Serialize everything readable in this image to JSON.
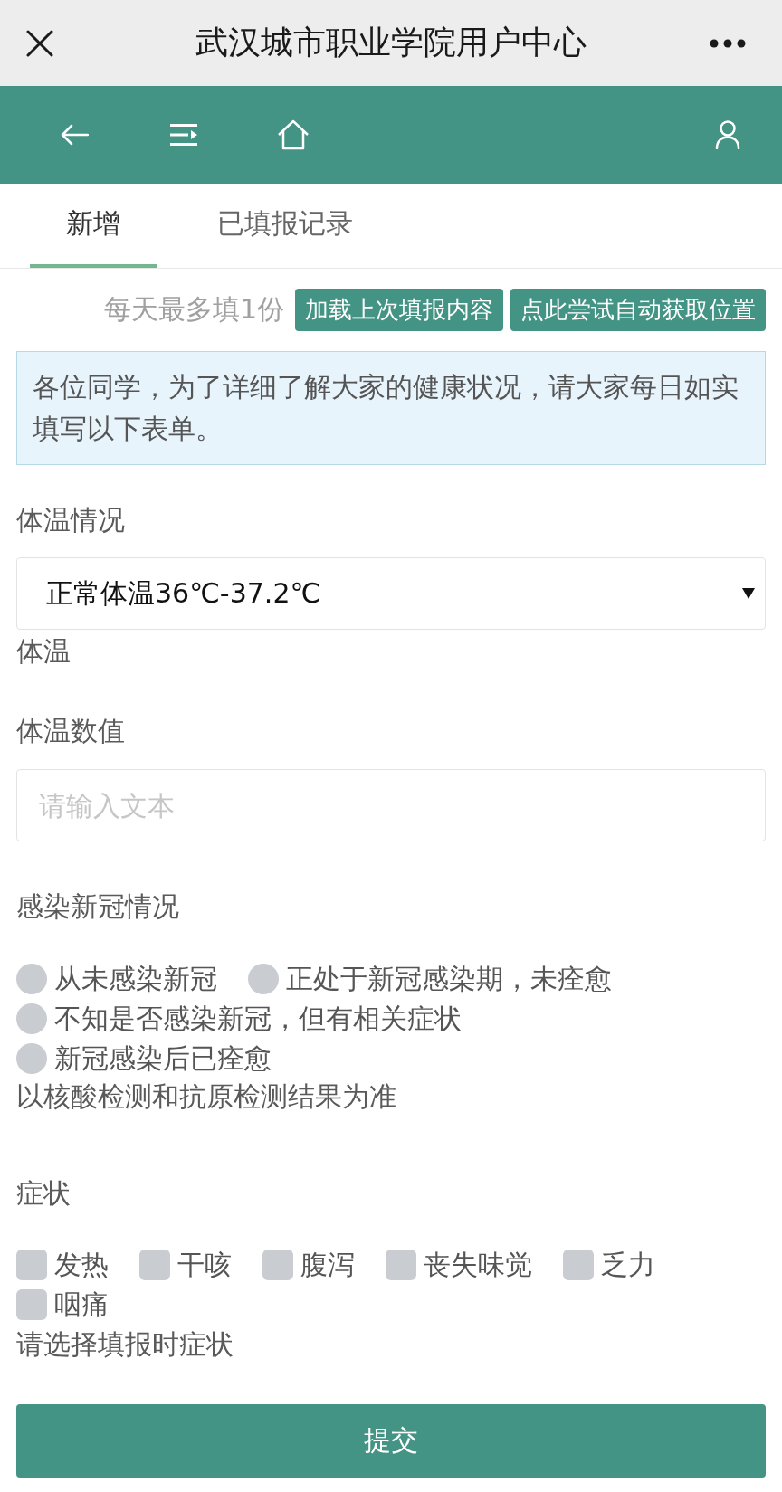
{
  "title_bar": {
    "title": "武汉城市职业学院用户中心"
  },
  "tabs": [
    {
      "label": "新增",
      "selected": true
    },
    {
      "label": "已填报记录",
      "selected": false
    }
  ],
  "toolbar": {
    "limit_note": "每天最多填1份",
    "buttons": [
      "加载上次填报内容",
      "点此尝试自动获取位置"
    ]
  },
  "notice": "各位同学，为了详细了解大家的健康状况，请大家每日如实填写以下表单。",
  "form": {
    "fields": [
      {
        "kind": "select",
        "label": "体温情况",
        "value": "正常体温36℃-37.2℃",
        "help": "体温"
      },
      {
        "kind": "text",
        "label": "体温数值",
        "placeholder": "请输入文本"
      },
      {
        "kind": "radio",
        "label": "感染新冠情况",
        "options": [
          {
            "label": "从未感染新冠",
            "selected": false
          },
          {
            "label": "正处于新冠感染期，未痊愈",
            "selected": false
          },
          {
            "label": "不知是否感染新冠，但有相关症状",
            "selected": false
          },
          {
            "label": "新冠感染后已痊愈",
            "selected": false
          }
        ],
        "help": "以核酸检测和抗原检测结果为准"
      },
      {
        "kind": "checkbox",
        "label": "症状",
        "options": [
          {
            "label": "发热",
            "checked": false
          },
          {
            "label": "干咳",
            "checked": false
          },
          {
            "label": "腹泻",
            "checked": false
          },
          {
            "label": "丧失味觉",
            "checked": false
          },
          {
            "label": "乏力",
            "checked": false
          },
          {
            "label": "咽痛",
            "checked": false
          }
        ],
        "help": "请选择填报时症状"
      }
    ]
  },
  "submit_button": "提交"
}
